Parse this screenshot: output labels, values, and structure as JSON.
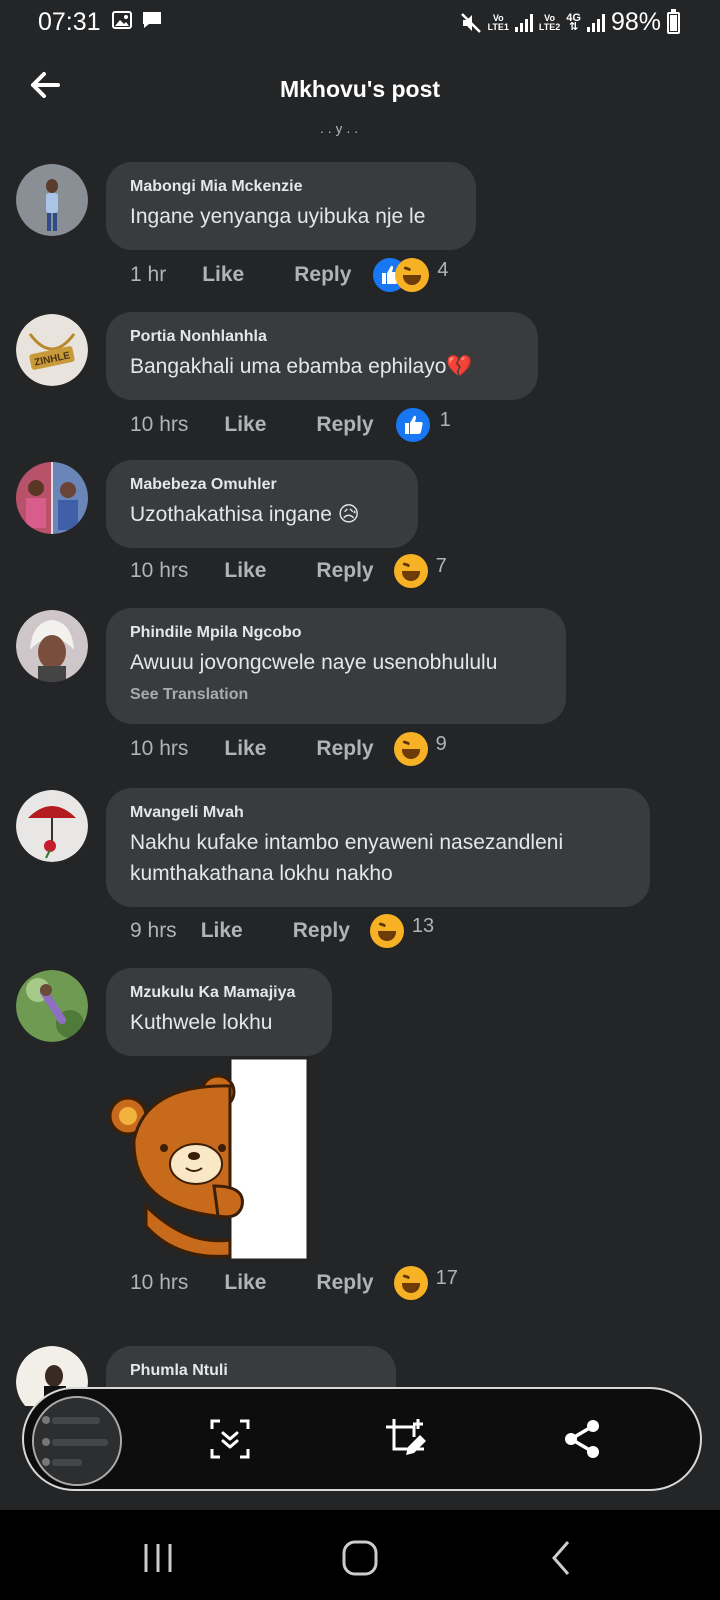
{
  "status_bar": {
    "time": "07:31",
    "sim1_label_top": "Vo",
    "sim1_label_bottom": "LTE1",
    "sim2_label_top": "Vo",
    "sim2_label_bottom": "LTE2",
    "network": "4G",
    "battery_text": "98%",
    "battery_level": 0.98
  },
  "header": {
    "title": "Mkhovu's post"
  },
  "partial_text_top": ". . y . .",
  "comments": [
    {
      "name": "Mabongi Mia Mckenzie",
      "text": "Ingane yenyanga uyibuka nje le",
      "time": "1 hr",
      "like_label": "Like",
      "reply_label": "Reply",
      "reactions": [
        "like",
        "haha"
      ],
      "reaction_count": "4"
    },
    {
      "name": "Portia Nonhlanhla",
      "text": "Bangakhali uma ebamba ephilayo💔",
      "time": "10 hrs",
      "like_label": "Like",
      "reply_label": "Reply",
      "reactions": [
        "like"
      ],
      "reaction_count": "1",
      "avatar_text": "ZINHLE"
    },
    {
      "name": "Mabebeza Omuhler",
      "text": "Uzothakathisa ingane 😥",
      "time": "10 hrs",
      "like_label": "Like",
      "reply_label": "Reply",
      "reactions": [
        "haha"
      ],
      "reaction_count": "7"
    },
    {
      "name": "Phindile Mpila Ngcobo",
      "text": "Awuuu jovongcwele naye usenobhululu",
      "see_translation": "See Translation",
      "time": "10 hrs",
      "like_label": "Like",
      "reply_label": "Reply",
      "reactions": [
        "haha"
      ],
      "reaction_count": "9"
    },
    {
      "name": "Mvangeli Mvah",
      "text": "Nakhu kufake intambo enyaweni nasezandleni kumthakathana lokhu nakho",
      "time": "9 hrs",
      "like_label": "Like",
      "reply_label": "Reply",
      "reactions": [
        "haha"
      ],
      "reaction_count": "13"
    },
    {
      "name": "Mzukulu Ka Mamajiya",
      "text": "Kuthwele lokhu",
      "sticker": "bear-peeking-door",
      "time": "10 hrs",
      "like_label": "Like",
      "reply_label": "Reply",
      "reactions": [
        "haha"
      ],
      "reaction_count": "17"
    },
    {
      "name": "Phumla Ntuli",
      "text": ""
    }
  ],
  "toolbar": {
    "icons": [
      "screenshot-thumbnail",
      "scroll-capture-icon",
      "crop-edit-icon",
      "share-icon"
    ]
  },
  "nav_bar": {
    "icons": [
      "recent-apps-icon",
      "home-icon",
      "back-nav-icon"
    ]
  },
  "colors": {
    "background": "#242527",
    "bubble": "#3a3b3c",
    "text": "#e4e6eb",
    "muted": "#b0b3b8",
    "like_blue": "#1877f2",
    "haha_yellow": "#f7b125"
  }
}
